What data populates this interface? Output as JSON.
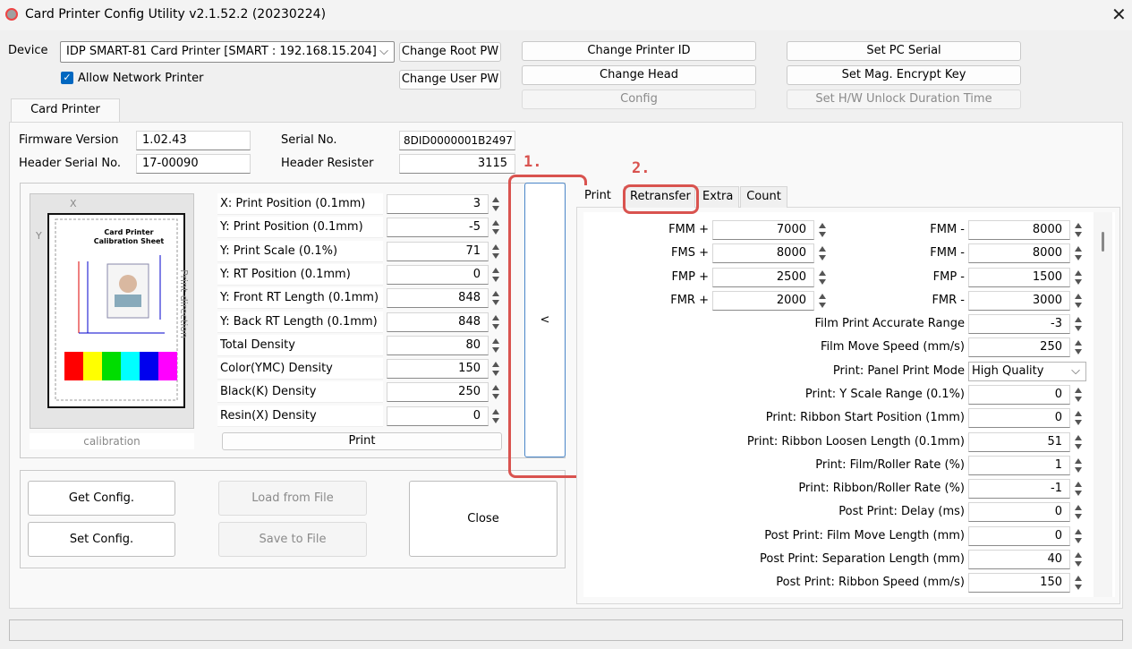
{
  "window": {
    "title": "Card Printer Config Utility v2.1.52.2 (20230224)"
  },
  "device": {
    "label": "Device",
    "selected": "IDP SMART-81 Card Printer  [SMART : 192.168.15.204]",
    "allow_network_label": "Allow Network Printer",
    "allow_network_checked": true
  },
  "top_buttons": {
    "change_root_pw": "Change Root PW",
    "change_user_pw": "Change User PW",
    "change_printer_id": "Change Printer ID",
    "change_head": "Change Head",
    "config": "Config",
    "set_pc_serial": "Set PC Serial",
    "set_mag_key": "Set Mag. Encrypt Key",
    "set_hw_unlock": "Set H/W Unlock Duration Time"
  },
  "main_tab": "Card Printer",
  "info": {
    "firmware_label": "Firmware Version",
    "firmware_value": "1.02.43",
    "serial_label": "Serial No.",
    "serial_value": "8DID0000001B2497",
    "header_serial_label": "Header Serial No.",
    "header_serial_value": "17-00090",
    "header_resister_label": "Header Resister",
    "header_resister_value": "3115"
  },
  "calibration": {
    "caption": "calibration",
    "sheet_title": "Card Printer",
    "sheet_subtitle": "Calibration Sheet",
    "print_direction": "Print direction",
    "x_axis": "X",
    "y_axis": "Y"
  },
  "left_params": [
    {
      "label": "X: Print Position (0.1mm)",
      "value": "3"
    },
    {
      "label": "Y: Print Position (0.1mm)",
      "value": "-5"
    },
    {
      "label": "Y: Print Scale (0.1%)",
      "value": "71"
    },
    {
      "label": "Y: RT Position (0.1mm)",
      "value": "0"
    },
    {
      "label": "Y: Front RT Length (0.1mm)",
      "value": "848"
    },
    {
      "label": "Y: Back RT Length (0.1mm)",
      "value": "848"
    },
    {
      "label": "Total Density",
      "value": "80"
    },
    {
      "label": "Color(YMC) Density",
      "value": "150"
    },
    {
      "label": "Black(K) Density",
      "value": "250"
    },
    {
      "label": "Resin(X) Density",
      "value": "0"
    }
  ],
  "print_button": "Print",
  "actions": {
    "get_config": "Get Config.",
    "set_config": "Set Config.",
    "load_from_file": "Load from File",
    "save_to_file": "Save to File",
    "close": "Close"
  },
  "collapse_button": "<",
  "annotations": {
    "one": "1.",
    "two": "2."
  },
  "right_tabs": [
    "Print",
    "Retransfer",
    "Extra",
    "Count"
  ],
  "fm_pairs": [
    {
      "l_label": "FMM +",
      "l_value": "7000",
      "r_label": "FMM -",
      "r_value": "8000"
    },
    {
      "l_label": "FMS +",
      "l_value": "8000",
      "r_label": "FMM -",
      "r_value": "8000"
    },
    {
      "l_label": "FMP +",
      "l_value": "2500",
      "r_label": "FMP -",
      "r_value": "1500"
    },
    {
      "l_label": "FMR +",
      "l_value": "2000",
      "r_label": "FMR -",
      "r_value": "3000"
    }
  ],
  "right_params": [
    {
      "label": "Film Print Accurate Range",
      "value": "-3"
    },
    {
      "label": "Film Move Speed (mm/s)",
      "value": "250"
    },
    {
      "label": "Print: Panel Print Mode",
      "value": "High Quality"
    },
    {
      "label": "Print: Y Scale Range (0.1%)",
      "value": "0"
    },
    {
      "label": "Print: Ribbon Start Position (1mm)",
      "value": "0"
    },
    {
      "label": "Print: Ribbon Loosen Length (0.1mm)",
      "value": "51"
    },
    {
      "label": "Print: Film/Roller Rate (%)",
      "value": "1"
    },
    {
      "label": "Print: Ribbon/Roller Rate (%)",
      "value": "-1"
    },
    {
      "label": "Post Print: Delay (ms)",
      "value": "0"
    },
    {
      "label": "Post Print: Film Move Length (mm)",
      "value": "0"
    },
    {
      "label": "Post Print: Separation Length (mm)",
      "value": "40"
    },
    {
      "label": "Post Print: Ribbon Speed (mm/s)",
      "value": "150"
    }
  ],
  "colors": {
    "accent": "#0067c0",
    "annotation": "#d9534f"
  }
}
